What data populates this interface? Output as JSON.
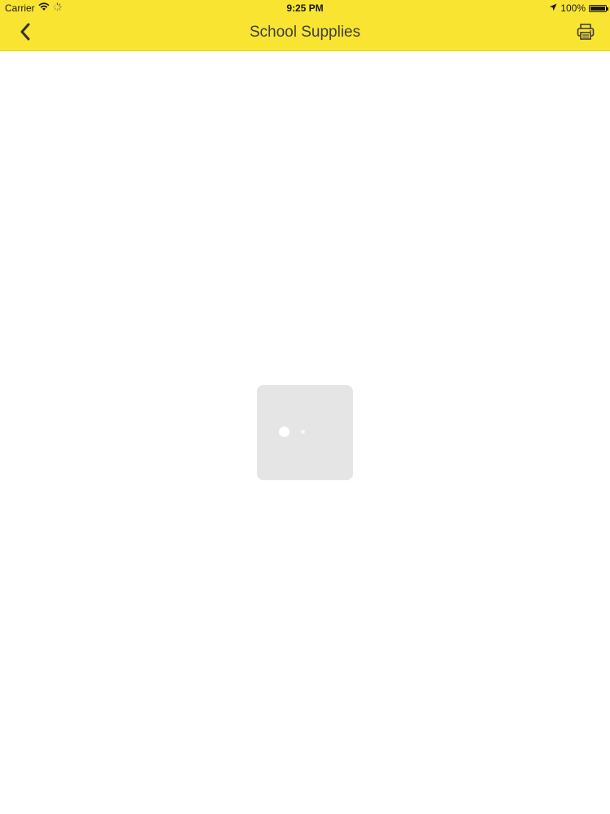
{
  "status_bar": {
    "carrier": "Carrier",
    "time": "9:25 PM",
    "battery": "100%",
    "battery_level": 1.0,
    "icons": [
      "wifi-icon",
      "activity-spinner-icon",
      "location-arrow-icon",
      "battery-icon"
    ]
  },
  "nav_bar": {
    "title": "School Supplies",
    "back_icon": "chevron-left-icon",
    "print_icon": "printer-icon",
    "background_color": "#f9e432"
  },
  "loading": {
    "indicator": "loading-spinner",
    "box_color": "#e6e5e6"
  }
}
